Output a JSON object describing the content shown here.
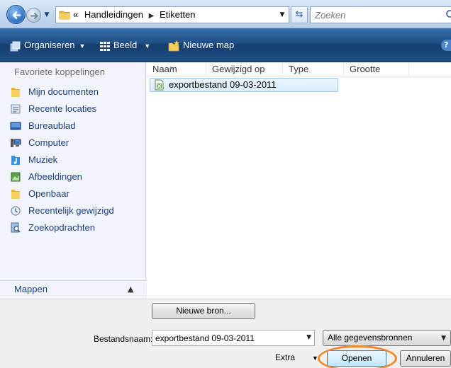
{
  "address": {
    "overflow_marker": "«",
    "crumbs": [
      "Handleidingen",
      "Etiketten"
    ]
  },
  "search": {
    "placeholder": "Zoeken"
  },
  "toolbar": {
    "organize_label": "Organiseren",
    "view_label": "Beeld",
    "new_folder_label": "Nieuwe map"
  },
  "nav": {
    "header": "Favoriete koppelingen",
    "items": [
      {
        "label": "Mijn documenten",
        "icon": "folder-icon"
      },
      {
        "label": "Recente locaties",
        "icon": "recent-places-icon"
      },
      {
        "label": "Bureaublad",
        "icon": "desktop-icon"
      },
      {
        "label": "Computer",
        "icon": "computer-icon"
      },
      {
        "label": "Muziek",
        "icon": "music-icon"
      },
      {
        "label": "Afbeeldingen",
        "icon": "pictures-icon"
      },
      {
        "label": "Openbaar",
        "icon": "folder-icon"
      },
      {
        "label": "Recentelijk gewijzigd",
        "icon": "recently-changed-icon"
      },
      {
        "label": "Zoekopdrachten",
        "icon": "searches-icon"
      }
    ],
    "folders_label": "Mappen"
  },
  "filelist": {
    "columns": [
      "Naam",
      "Gewijzigd op",
      "Type",
      "Grootte"
    ],
    "files": [
      {
        "name": "exportbestand 09-03-2011",
        "icon": "excel-file-icon",
        "selected": true
      }
    ]
  },
  "bottom": {
    "new_source_label": "Nieuwe bron...",
    "filename_label": "Bestandsnaam:",
    "filename_value": "exportbestand 09-03-2011",
    "filetype_value": "Alle gegevensbronnen",
    "extra_label": "Extra",
    "open_label": "Openen",
    "cancel_label": "Annuleren"
  },
  "colors": {
    "toolbar_bg": "#1e4e86",
    "nav_link": "#1a3f84",
    "highlight_ring": "#f28a2c",
    "selection_border": "#99c6f1"
  }
}
